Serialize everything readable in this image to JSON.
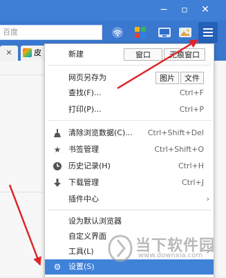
{
  "window": {
    "minimize": "−",
    "maximize": "▫",
    "close": "✕"
  },
  "toolbar": {
    "address_fragment": "百度"
  },
  "tabs": {
    "fragment_label": "皮"
  },
  "menu": {
    "new_label": "新建",
    "new_window": "窗口",
    "new_incognito": "无痕窗口",
    "save_as_label": "网页另存为",
    "save_image": "图片",
    "save_file": "文件",
    "items": [
      {
        "label": "查找(F)...",
        "shortcut": "Ctrl+F"
      },
      {
        "label": "打印(P)...",
        "shortcut": "Ctrl+P"
      },
      {
        "label": "清除浏览数据(C)...",
        "shortcut": "Ctrl+Shift+Del"
      },
      {
        "label": "书签管理",
        "shortcut": "Ctrl+Shift+O"
      },
      {
        "label": "历史记录(H)",
        "shortcut": "Ctrl+H"
      },
      {
        "label": "下载管理",
        "shortcut": "Ctrl+J"
      },
      {
        "label": "插件中心",
        "shortcut": ""
      },
      {
        "label": "设为默认浏览器",
        "shortcut": ""
      },
      {
        "label": "自定义界面",
        "shortcut": ""
      },
      {
        "label": "工具(L)",
        "shortcut": ""
      },
      {
        "label": "设置(S)",
        "shortcut": ""
      }
    ]
  },
  "watermark": {
    "brand": "当下软件园",
    "url": "www.downxia.com"
  },
  "colors": {
    "titlebar": "#3f7fd6",
    "highlight": "#3f82d8",
    "arrow": "#e0252a"
  }
}
